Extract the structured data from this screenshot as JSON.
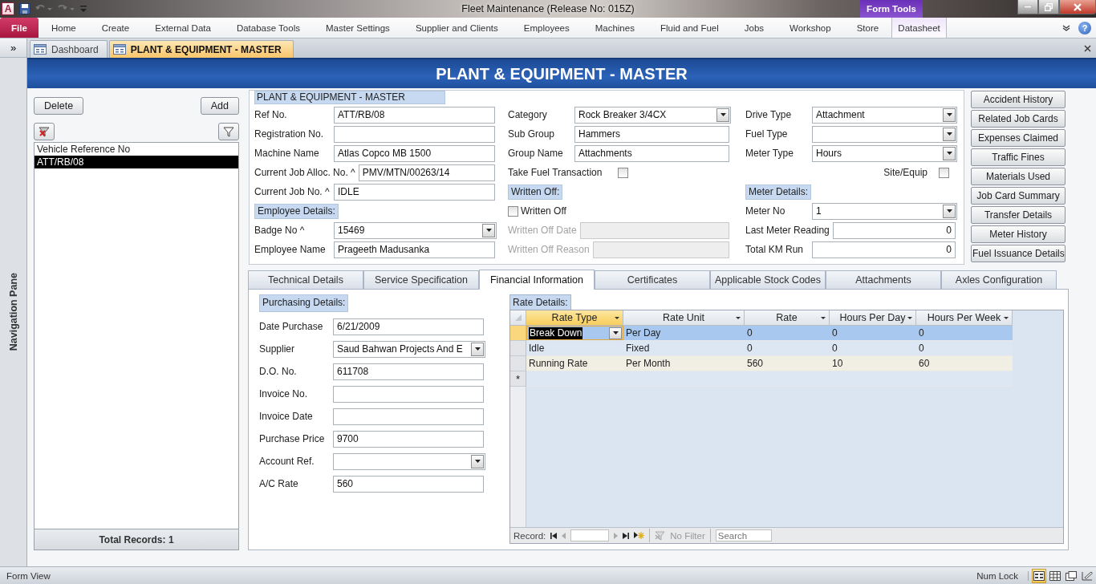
{
  "window": {
    "app_logo": "A",
    "title": "Fleet Maintenance (Release No: 015Z)",
    "context_group": "Form Tools",
    "help": "?"
  },
  "ribbon_tabs": [
    {
      "label": "File",
      "kind": "file",
      "selected": false
    },
    {
      "label": "Home",
      "kind": "tab",
      "selected": false
    },
    {
      "label": "Create",
      "kind": "tab",
      "selected": false
    },
    {
      "label": "External Data",
      "kind": "tab",
      "selected": false
    },
    {
      "label": "Database Tools",
      "kind": "tab",
      "selected": false
    },
    {
      "label": "Master Settings",
      "kind": "tab",
      "selected": false
    },
    {
      "label": "Supplier and Clients",
      "kind": "tab",
      "selected": false
    },
    {
      "label": "Employees",
      "kind": "tab",
      "selected": false
    },
    {
      "label": "Machines",
      "kind": "tab",
      "selected": false
    },
    {
      "label": "Fluid and Fuel",
      "kind": "tab",
      "selected": false
    },
    {
      "label": "Jobs",
      "kind": "tab",
      "selected": false
    },
    {
      "label": "Workshop",
      "kind": "tab",
      "selected": false
    },
    {
      "label": "Store",
      "kind": "tab",
      "selected": false
    },
    {
      "label": "Datasheet",
      "kind": "context",
      "selected": false
    }
  ],
  "navigation_pane": {
    "toggle": "»",
    "label": "Navigation Pane"
  },
  "document_tabs": [
    {
      "label": "Dashboard",
      "selected": false
    },
    {
      "label": "PLANT & EQUIPMENT - MASTER",
      "selected": true
    }
  ],
  "form": {
    "title": "PLANT & EQUIPMENT - MASTER",
    "record_list": {
      "buttons": [
        "Delete",
        "Add"
      ],
      "column": "Vehicle Reference No",
      "rows": [
        {
          "text": "ATT/RB/08",
          "selected": true
        }
      ],
      "footer": "Total Records: 1"
    },
    "master": {
      "title": "PLANT & EQUIPMENT - MASTER",
      "columns": [
        [
          {
            "kind": "text",
            "label": "Ref No.",
            "value": "ATT/RB/08",
            "disabled": false
          },
          {
            "kind": "text",
            "label": "Registration No.",
            "disabled": false
          },
          {
            "kind": "text",
            "label": "Machine Name",
            "value": "Atlas Copco MB 1500",
            "disabled": false
          },
          {
            "kind": "text",
            "label": "Current Job Alloc. No. ^",
            "value": "PMV/MTN/00263/14",
            "disabled": false
          },
          {
            "kind": "text",
            "label": "Current Job No. ^",
            "value": "IDLE",
            "disabled": false
          },
          {
            "kind": "section",
            "label": "Employee Details:"
          },
          {
            "kind": "combo",
            "label": "Badge No ^",
            "value": "15469",
            "disabled": false
          },
          {
            "kind": "text",
            "label": "Employee Name",
            "value": "Prageeth Madusanka",
            "disabled": false
          }
        ],
        [
          {
            "kind": "combo",
            "label": "Category",
            "value": "Rock Breaker 3/4CX",
            "disabled": false
          },
          {
            "kind": "text",
            "label": "Sub Group",
            "value": "Hammers",
            "disabled": false
          },
          {
            "kind": "text",
            "label": "Group Name",
            "value": "Attachments",
            "disabled": false
          },
          {
            "kind": "checkbox",
            "label": "Take Fuel Transaction",
            "checked": false,
            "disabled": false
          },
          {
            "kind": "section",
            "label": "Written Off:"
          },
          {
            "kind": "option",
            "label": "Written Off",
            "checked": false,
            "disabled": false
          },
          {
            "kind": "text",
            "label": "Written Off Date",
            "disabled": true
          },
          {
            "kind": "text",
            "label": "Written Off Reason",
            "disabled": true
          }
        ],
        [
          {
            "kind": "combo",
            "label": "Drive Type",
            "value": "Attachment",
            "disabled": false
          },
          {
            "kind": "combo",
            "label": "Fuel Type",
            "disabled": false
          },
          {
            "kind": "combo",
            "label": "Meter Type",
            "value": "Hours",
            "disabled": false
          },
          {
            "kind": "checkbox_right",
            "label": "Site/Equip",
            "checked": false,
            "disabled": false
          },
          {
            "kind": "section",
            "label": "Meter Details:"
          },
          {
            "kind": "combo",
            "label": "Meter No",
            "value": "1",
            "disabled": false
          },
          {
            "kind": "number",
            "label": "Last Meter Reading",
            "value": "0",
            "disabled": false
          },
          {
            "kind": "number",
            "label": "Total KM Run",
            "value": "0",
            "disabled": false
          }
        ]
      ]
    },
    "side_buttons": [
      "Accident History",
      "Related Job Cards",
      "Expenses Claimed",
      "Traffic Fines",
      "Materials Used",
      "Job Card Summary",
      "Transfer Details",
      "Meter History",
      "Fuel Issuance Details"
    ],
    "tabs": [
      {
        "label": "Technical Details",
        "selected": false
      },
      {
        "label": "Service Specification",
        "selected": false
      },
      {
        "label": "Financial Information",
        "selected": true
      },
      {
        "label": "Certificates",
        "selected": false
      },
      {
        "label": "Applicable Stock Codes",
        "selected": false
      },
      {
        "label": "Attachments",
        "selected": false
      },
      {
        "label": "Axles Configuration",
        "selected": false
      }
    ],
    "purchasing": {
      "title": "Purchasing Details:",
      "fields": [
        {
          "kind": "text",
          "label": "Date Purchase",
          "value": "6/21/2009"
        },
        {
          "kind": "combo",
          "label": "Supplier",
          "value": "Saud Bahwan Projects And E"
        },
        {
          "kind": "text",
          "label": "D.O. No.",
          "value": "611708"
        },
        {
          "kind": "text",
          "label": "Invoice No."
        },
        {
          "kind": "text",
          "label": "Invoice Date"
        },
        {
          "kind": "text",
          "label": "Purchase Price",
          "value": "9700"
        },
        {
          "kind": "combo",
          "label": "Account Ref."
        },
        {
          "kind": "text",
          "label": "A/C Rate",
          "value": "560"
        }
      ]
    },
    "rates": {
      "title": "Rate Details:",
      "columns": [
        {
          "label": "Rate Type",
          "selected": true
        },
        {
          "label": "Rate Unit",
          "selected": false
        },
        {
          "label": "Rate",
          "selected": false
        },
        {
          "label": "Hours Per Day",
          "selected": false
        },
        {
          "label": "Hours Per Week",
          "selected": false
        }
      ],
      "rows": [
        {
          "cells": [
            "Break Down",
            "Per Day",
            "0",
            "0",
            "0"
          ],
          "selected": true
        },
        {
          "cells": [
            "Idle",
            "Fixed",
            "0",
            "0",
            "0"
          ],
          "selected": false
        },
        {
          "cells": [
            "Running Rate",
            "Per Month",
            "560",
            "10",
            "60"
          ],
          "selected": false
        }
      ],
      "new_row_marker": "*",
      "navigator": {
        "label": "Record:",
        "filter": "No Filter",
        "search_placeholder": "Search"
      }
    }
  },
  "status_bar": {
    "mode": "Form View",
    "indicator": "Num Lock",
    "views": [
      {
        "kind": "form",
        "selected": true
      },
      {
        "kind": "datasheet",
        "selected": false
      },
      {
        "kind": "layout",
        "selected": false
      },
      {
        "kind": "design",
        "selected": false
      }
    ]
  }
}
